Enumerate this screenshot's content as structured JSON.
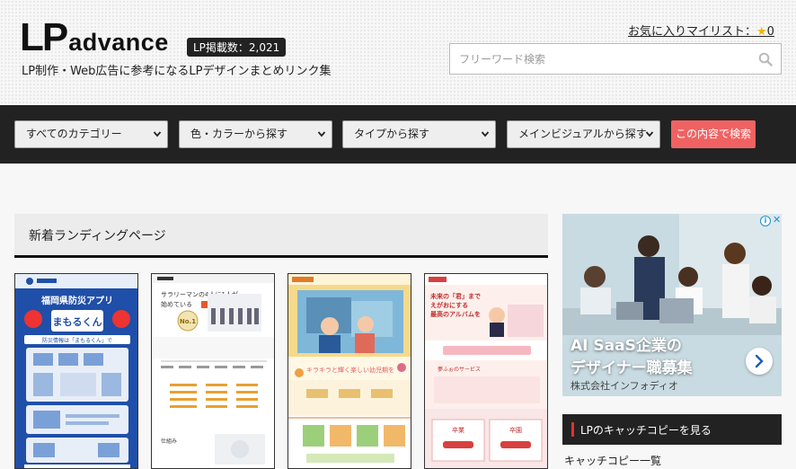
{
  "header": {
    "logo_lp": "LP",
    "logo_advance": "advance",
    "count_badge": "LP掲載数：2,021",
    "tagline": "LP制作・Web広告に参考になるLPデザインまとめリンク集",
    "mylist_label": "お気に入りマイリスト：",
    "mylist_star": "★",
    "mylist_count": "0",
    "search_placeholder": "フリーワード検索"
  },
  "filters": {
    "category": "すべてのカテゴリー",
    "color": "色・カラーから探す",
    "type": "タイプから探す",
    "visual": "メインビジュアルから探す",
    "submit": "この内容で検索"
  },
  "main": {
    "heading": "新着ランディングページ",
    "cards": [
      {
        "l1": "福岡県防災アプリ",
        "l2": "まもるくん",
        "l3": "防災情報は「まもるくん」で"
      },
      {
        "l1": "サラリーマンの4人に1人が",
        "l2": "始めている",
        "l3": "No.1",
        "l4": "仕組み"
      },
      {
        "l1": "キラキラと輝く楽しい幼児期を"
      },
      {
        "l1": "未来の「君」まで",
        "l2": "えがおにする",
        "l3": "最高のアルバムを",
        "l4": "夢ふぉのサービス",
        "l5": "卒業",
        "l6": "卒園"
      }
    ]
  },
  "ad": {
    "title1": "AI SaaS企業の",
    "title2": "デザイナー職募集",
    "company": "株式会社インフォディオ",
    "info": "i",
    "close": "✕"
  },
  "sidebar": {
    "heading": "LPのキャッチコピーを見る",
    "link": "キャッチコピー一覧"
  },
  "colors": {
    "filter_bar": "#222222",
    "search_button": "#f06262",
    "badge": "#222222",
    "star": "#f0b400"
  }
}
